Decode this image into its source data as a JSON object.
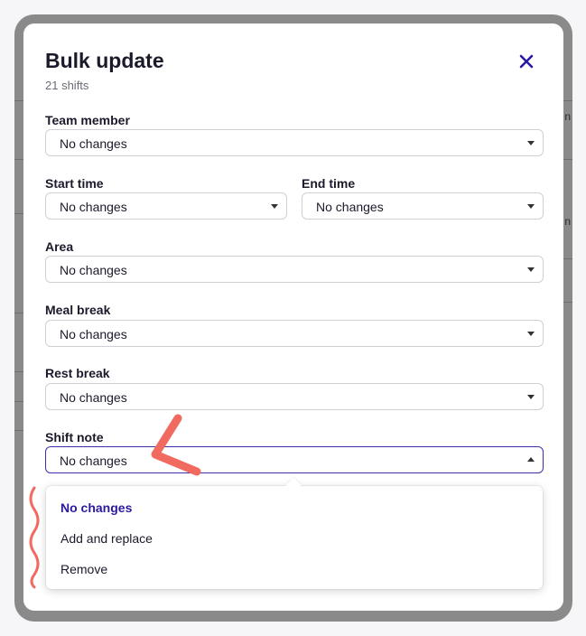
{
  "dialog": {
    "title": "Bulk update",
    "subtitle": "21 shifts",
    "close_icon": "close-icon"
  },
  "fields": {
    "team_member": {
      "label": "Team member",
      "value": "No changes"
    },
    "start_time": {
      "label": "Start time",
      "value": "No changes"
    },
    "end_time": {
      "label": "End time",
      "value": "No changes"
    },
    "area": {
      "label": "Area",
      "value": "No changes"
    },
    "meal_break": {
      "label": "Meal break",
      "value": "No changes"
    },
    "rest_break": {
      "label": "Rest break",
      "value": "No changes"
    },
    "shift_note": {
      "label": "Shift note",
      "value": "No changes"
    }
  },
  "shift_note_dropdown": {
    "options": [
      {
        "label": "No changes",
        "selected": true
      },
      {
        "label": "Add and replace",
        "selected": false
      },
      {
        "label": "Remove",
        "selected": false
      }
    ]
  },
  "colors": {
    "accent": "#2a1aa0",
    "annotation": "#f06a60"
  }
}
